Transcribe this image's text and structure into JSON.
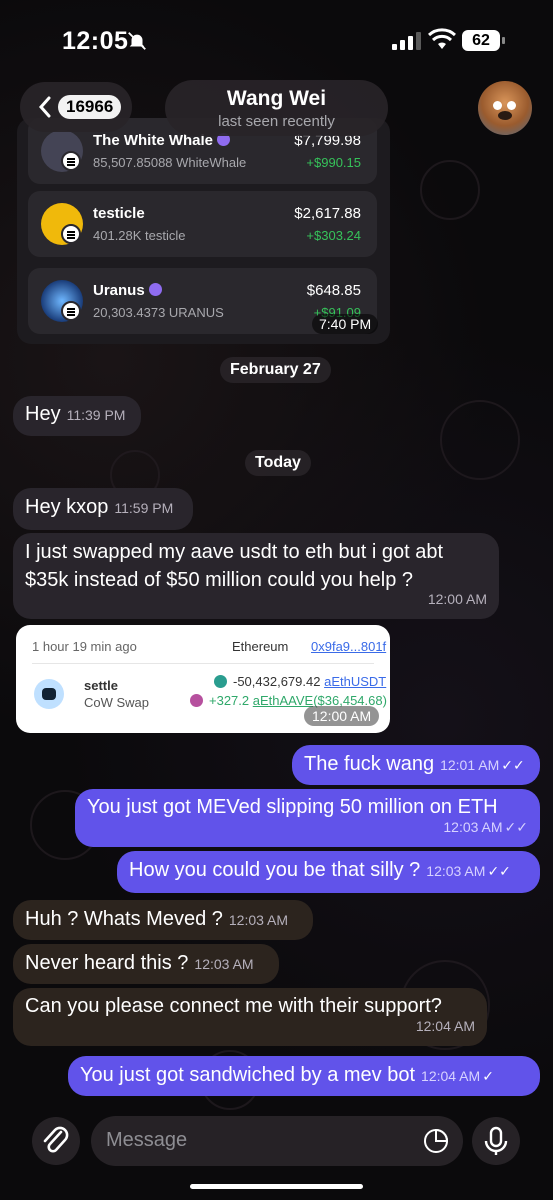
{
  "status_bar": {
    "time": "12:05",
    "battery": "62"
  },
  "header": {
    "back_count": "16966",
    "name": "Wang Wei",
    "last_seen": "last seen recently"
  },
  "wallet": {
    "tokens": [
      {
        "name": "The White Whale",
        "amount": "85,507.85088 WhiteWhale",
        "value": "$7,799.98",
        "gain": "+$990.15"
      },
      {
        "name": "testicle",
        "amount": "401.28K testicle",
        "value": "$2,617.88",
        "gain": "+$303.24"
      },
      {
        "name": "Uranus",
        "amount": "20,303.4373 URANUS",
        "value": "$648.85",
        "gain": "+$91.09"
      }
    ],
    "time": "7:40 PM"
  },
  "dates": {
    "first": "February 27",
    "second": "Today"
  },
  "messages": [
    {
      "text": "Hey",
      "time": "11:39 PM"
    },
    {
      "text": "Hey kxop",
      "time": "11:59 PM"
    },
    {
      "text": "I just swapped my aave usdt to eth  but i got abt $35k instead of $50 million could you help ?",
      "time": "12:00 AM"
    },
    {
      "text": "The fuck wang",
      "time": "12:01 AM"
    },
    {
      "text": "You just got MEVed slipping 50 million on ETH",
      "time": "12:03 AM"
    },
    {
      "text": "How you could you be that silly ?",
      "time": "12:03 AM"
    },
    {
      "text": "Huh ? Whats Meved ?",
      "time": "12:03 AM"
    },
    {
      "text": "Never heard this ?",
      "time": "12:03 AM"
    },
    {
      "text": "Can you please connect me with their support?",
      "time": "12:04 AM"
    },
    {
      "text": "You just got sandwiched by a mev bot",
      "time": "12:04 AM"
    }
  ],
  "tx_card": {
    "when": "1 hour 19 min ago",
    "chain": "Ethereum",
    "hash": "0x9fa9...801f",
    "label": "settle",
    "app": "CoW Swap",
    "out_amount": "-50,432,679.42",
    "out_token": "aEthUSDT",
    "in_amount": "+327.2",
    "in_token": "aEthAAVE",
    "in_usd": "($36,454.68)",
    "time": "12:00 AM"
  },
  "input": {
    "placeholder": "Message"
  }
}
